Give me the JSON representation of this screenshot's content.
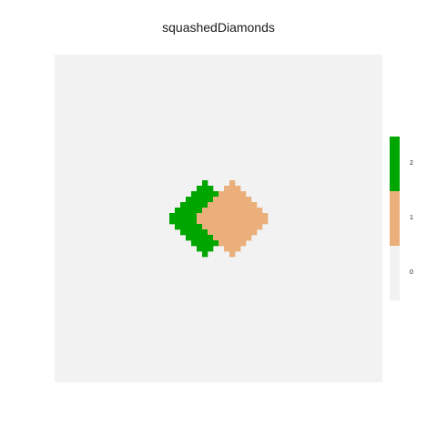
{
  "chart_data": {
    "type": "heatmap",
    "title": "squashedDiamonds",
    "xlabel": "",
    "ylabel": "",
    "grid": false,
    "grid_size": 60,
    "colors": {
      "0": "#f2f2f2",
      "1": "#eaaf7a",
      "2": "#00a600"
    },
    "legend": {
      "placement": "right",
      "entries": [
        {
          "value": 2,
          "label": "2",
          "color": "#00a600"
        },
        {
          "value": 1,
          "label": "1",
          "color": "#eaaf7a"
        },
        {
          "value": 0,
          "label": "0",
          "color": "#f2f2f2"
        }
      ]
    },
    "shapes": [
      {
        "name": "left-diamond",
        "value": 2,
        "center": [
          27,
          29.5
        ],
        "half_width": 7,
        "half_height": 7
      },
      {
        "name": "right-diamond",
        "value": 1,
        "center": [
          32,
          29.5
        ],
        "half_width": 7,
        "half_height": 7
      }
    ]
  }
}
